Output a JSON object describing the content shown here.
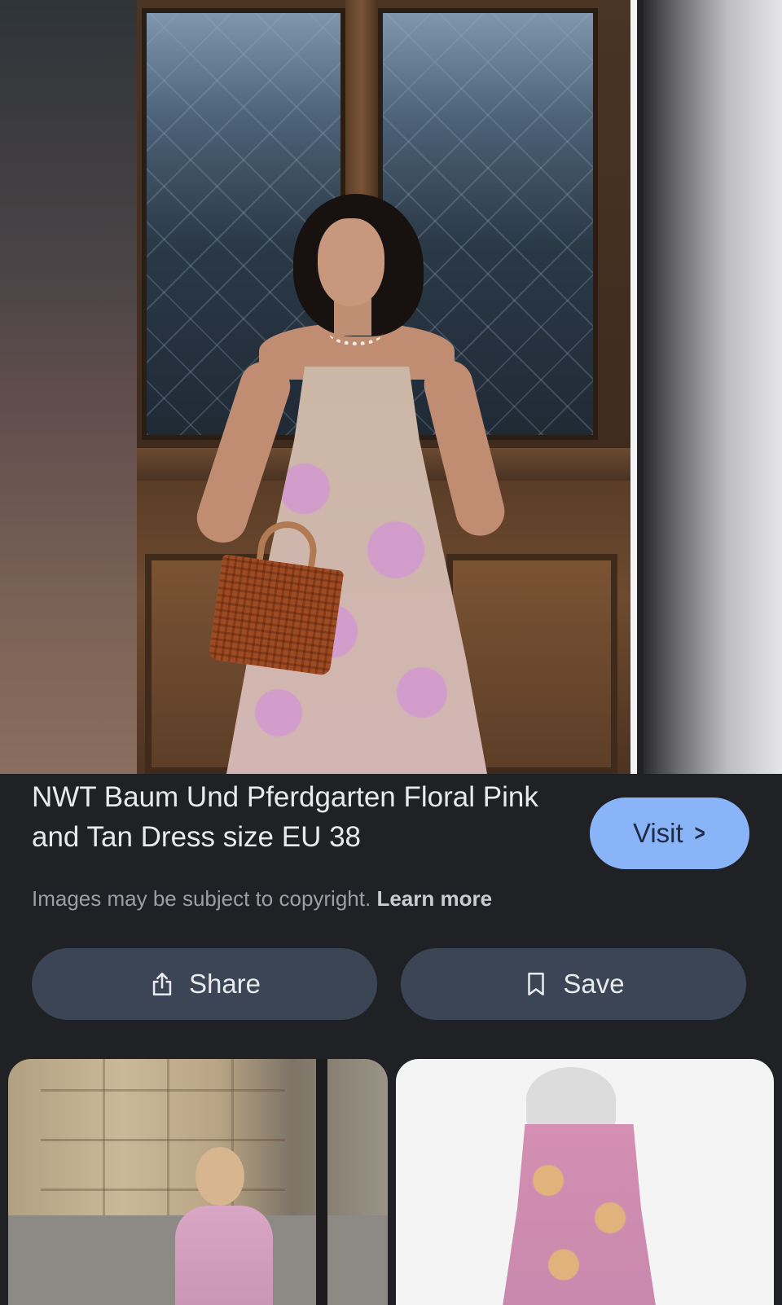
{
  "result": {
    "title": "NWT Baum Und Pferdgarten Floral Pink and Tan Dress size EU 38",
    "visit_label": "Visit",
    "copyright_text": "Images may be subject to copyright.",
    "learn_more_label": "Learn more"
  },
  "actions": {
    "share_label": "Share",
    "save_label": "Save"
  },
  "icons": {
    "visit": "chevron-right-icon",
    "share": "share-icon",
    "save": "bookmark-icon"
  },
  "colors": {
    "background": "#202124",
    "visit_button": "#8ab4f8",
    "action_button": "#3c4556",
    "text_primary": "#e8eaed",
    "text_secondary": "#9aa0a6"
  }
}
